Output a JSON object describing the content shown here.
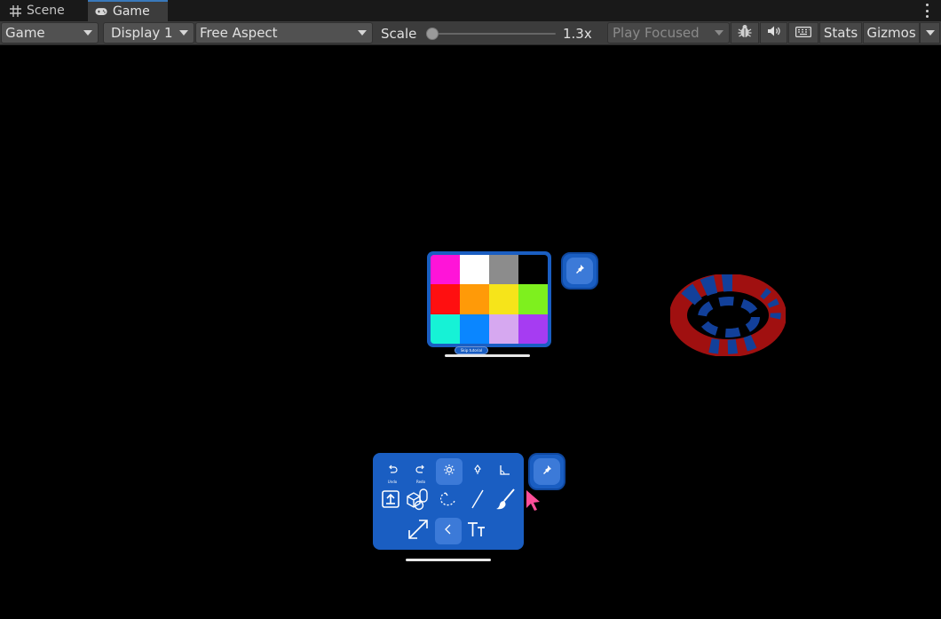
{
  "tabs": [
    {
      "label": "Scene",
      "icon": "grid-icon"
    },
    {
      "label": "Game",
      "icon": "gamepad-icon",
      "active": true
    }
  ],
  "toolbar": {
    "view_mode": "Game",
    "display": "Display 1",
    "aspect": "Free Aspect",
    "scale_label": "Scale",
    "scale_value": "1.3x",
    "scale_fraction": 0.05,
    "play_mode": "Play Focused",
    "stats": "Stats",
    "gizmos": "Gizmos"
  },
  "palette": {
    "colors": [
      "#ff14d8",
      "#ffffff",
      "#8c8c8c",
      "#000000",
      "#ff0f10",
      "#ff9a08",
      "#f6e41a",
      "#7ef01e",
      "#16f2d6",
      "#0a86ff",
      "#d6a8f0",
      "#a63cf2"
    ],
    "caption": "Skip tutorial"
  },
  "tools": {
    "row1": [
      {
        "name": "undo-tool",
        "icon": "undo-icon",
        "caption": "Undo"
      },
      {
        "name": "redo-tool",
        "icon": "redo-icon",
        "caption": "Redo"
      },
      {
        "name": "brightness-tool",
        "icon": "sun-icon",
        "selected": true
      },
      {
        "name": "pin-tool",
        "icon": "pin-icon"
      },
      {
        "name": "angle-tool",
        "icon": "angle-icon"
      }
    ],
    "row2": [
      {
        "name": "import-tool",
        "icon": "import-icon"
      },
      {
        "name": "shapes-tool",
        "icon": "shapes-icon"
      },
      {
        "name": "lasso-tool",
        "icon": "lasso-icon"
      },
      {
        "name": "line-tool",
        "icon": "line-icon"
      },
      {
        "name": "brush-tool",
        "icon": "brush-icon"
      }
    ],
    "row3": [
      {
        "name": "resize-tool",
        "icon": "expand-icon"
      },
      {
        "name": "back-tool",
        "icon": "chevron-left-icon"
      },
      {
        "name": "text-tool",
        "icon": "text-icon"
      }
    ]
  },
  "colors": {
    "panel_blue": "#1a5ec2",
    "tab_accent": "#3a79bb",
    "cursor": "#ff4f9a",
    "ring_red": "#a01010",
    "ring_blue": "#12409a"
  }
}
